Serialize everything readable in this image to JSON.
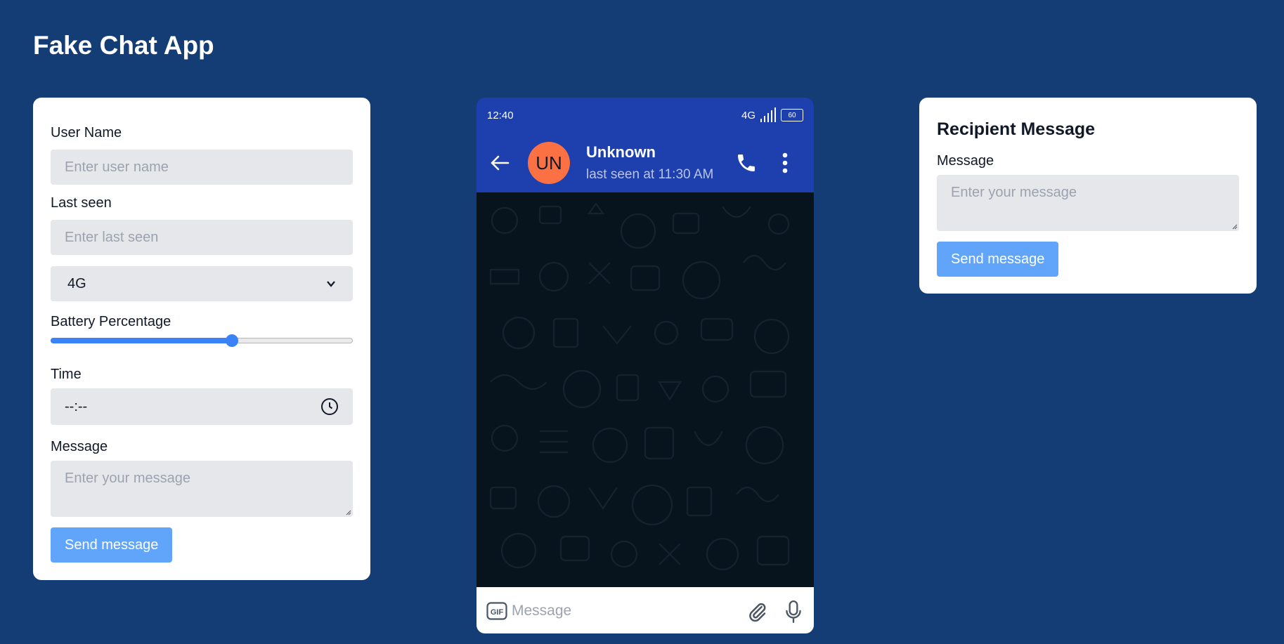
{
  "app": {
    "title": "Fake Chat App"
  },
  "settings": {
    "username_label": "User Name",
    "username_placeholder": "Enter user name",
    "lastseen_label": "Last seen",
    "lastseen_placeholder": "Enter last seen",
    "network_selected": "4G",
    "battery_label": "Battery Percentage",
    "battery_value": 60,
    "time_label": "Time",
    "time_value": "--:--",
    "message_label": "Message",
    "message_placeholder": "Enter your message",
    "send_label": "Send message"
  },
  "phone": {
    "status_time": "12:40",
    "network": "4G",
    "battery_text": "60",
    "contact_initials": "UN",
    "contact_name": "Unknown",
    "contact_status": "last seen at 11:30 AM",
    "input_placeholder": "Message",
    "gif_label": "GIF",
    "colors": {
      "header": "#1e3fae",
      "avatar": "#fb7144",
      "chat_bg": "#07141d"
    }
  },
  "recipient": {
    "heading": "Recipient Message",
    "message_label": "Message",
    "message_placeholder": "Enter your message",
    "send_label": "Send message"
  },
  "colors": {
    "page_bg": "#143d75",
    "accent": "#3b82f6",
    "button": "#60a5fa"
  }
}
